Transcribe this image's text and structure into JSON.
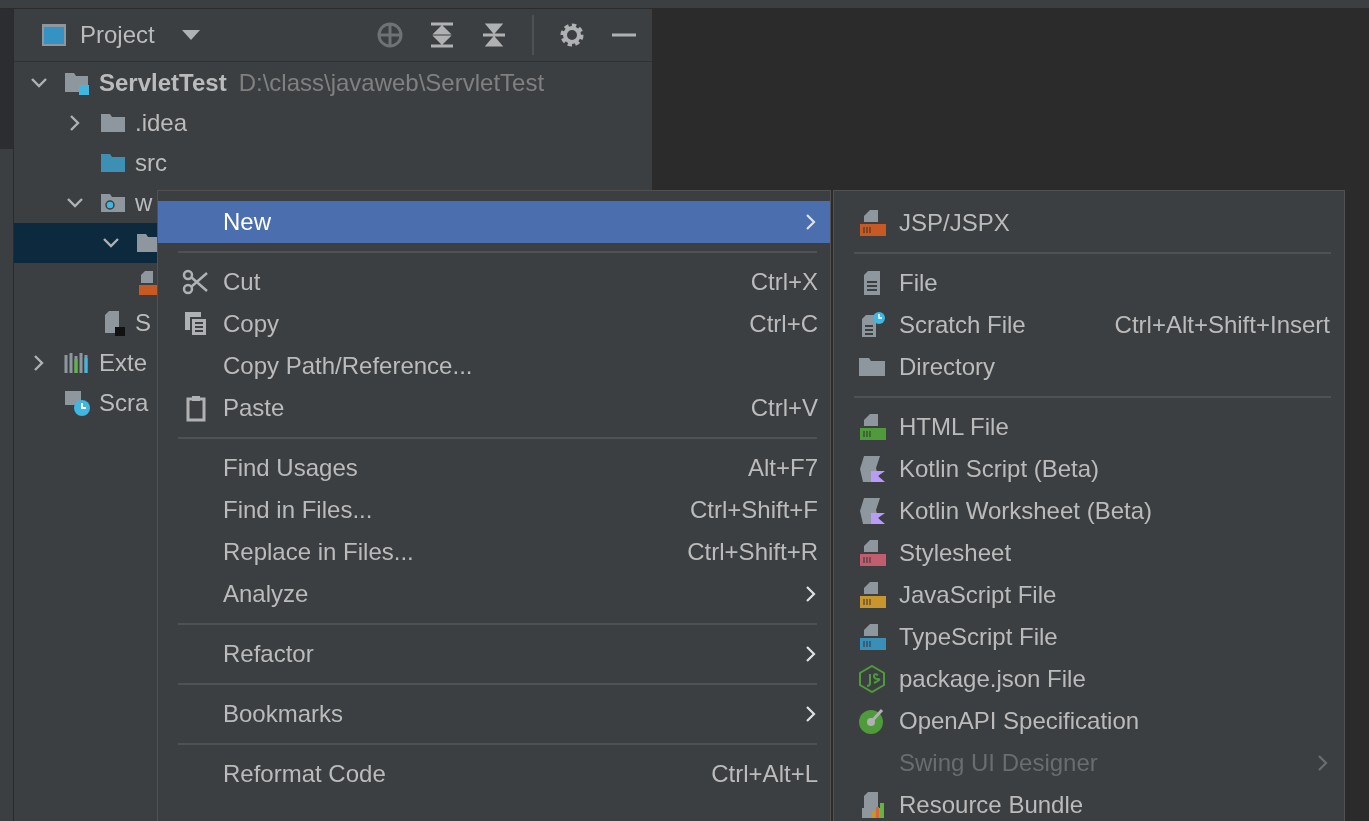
{
  "panel": {
    "title": "Project"
  },
  "tree": [
    {
      "kind": "module",
      "label": "ServletTest",
      "path": "D:\\class\\javaweb\\ServletTest",
      "expanded": true,
      "selected": false,
      "children": [
        {
          "kind": "folder",
          "label": ".idea",
          "expanded": false,
          "selected": false
        },
        {
          "kind": "source",
          "label": "src",
          "selected": false
        },
        {
          "kind": "web",
          "label": "w",
          "expanded": true,
          "selected": false,
          "children": [
            {
              "kind": "folder",
              "expanded": true,
              "selected": true
            },
            {
              "kind": "jsp",
              "selected": false
            }
          ]
        },
        {
          "kind": "iml",
          "label": "S",
          "selected": false
        }
      ]
    },
    {
      "kind": "library",
      "label": "Exte",
      "expanded": false,
      "selected": false
    },
    {
      "kind": "scratch",
      "label": "Scra",
      "selected": false
    }
  ],
  "context_menu": [
    {
      "kind": "item",
      "label": "New",
      "submenu": true,
      "selected": true
    },
    {
      "kind": "separator"
    },
    {
      "kind": "item",
      "label": "Cut",
      "shortcut": "Ctrl+X",
      "selected": false
    },
    {
      "kind": "item",
      "label": "Copy",
      "shortcut": "Ctrl+C",
      "selected": false
    },
    {
      "kind": "item",
      "label": "Copy Path/Reference...",
      "selected": false
    },
    {
      "kind": "item",
      "label": "Paste",
      "shortcut": "Ctrl+V",
      "selected": false
    },
    {
      "kind": "separator"
    },
    {
      "kind": "item",
      "label": "Find Usages",
      "shortcut": "Alt+F7",
      "selected": false
    },
    {
      "kind": "item",
      "label": "Find in Files...",
      "shortcut": "Ctrl+Shift+F",
      "selected": false
    },
    {
      "kind": "item",
      "label": "Replace in Files...",
      "shortcut": "Ctrl+Shift+R",
      "selected": false
    },
    {
      "kind": "item",
      "label": "Analyze",
      "submenu": true,
      "selected": false
    },
    {
      "kind": "separator"
    },
    {
      "kind": "item",
      "label": "Refactor",
      "submenu": true,
      "selected": false
    },
    {
      "kind": "separator"
    },
    {
      "kind": "item",
      "label": "Bookmarks",
      "submenu": true,
      "selected": false
    },
    {
      "kind": "separator"
    },
    {
      "kind": "item",
      "label": "Reformat Code",
      "shortcut": "Ctrl+Alt+L",
      "selected": false
    }
  ],
  "new_submenu": [
    {
      "kind": "item",
      "label": "JSP/JSPX",
      "disabled": false
    },
    {
      "kind": "separator"
    },
    {
      "kind": "item",
      "label": "File",
      "disabled": false
    },
    {
      "kind": "item",
      "label": "Scratch File",
      "shortcut": "Ctrl+Alt+Shift+Insert",
      "disabled": false
    },
    {
      "kind": "item",
      "label": "Directory",
      "disabled": false
    },
    {
      "kind": "separator"
    },
    {
      "kind": "item",
      "label": "HTML File",
      "disabled": false
    },
    {
      "kind": "item",
      "label": "Kotlin Script (Beta)",
      "disabled": false
    },
    {
      "kind": "item",
      "label": "Kotlin Worksheet (Beta)",
      "disabled": false
    },
    {
      "kind": "item",
      "label": "Stylesheet",
      "disabled": false
    },
    {
      "kind": "item",
      "label": "JavaScript File",
      "disabled": false
    },
    {
      "kind": "item",
      "label": "TypeScript File",
      "disabled": false
    },
    {
      "kind": "item",
      "label": "package.json File",
      "disabled": false
    },
    {
      "kind": "item",
      "label": "OpenAPI Specification",
      "disabled": false
    },
    {
      "kind": "item",
      "label": "Swing UI Designer",
      "submenu": true,
      "disabled": true
    },
    {
      "kind": "item",
      "label": "Resource Bundle",
      "disabled": false
    }
  ]
}
